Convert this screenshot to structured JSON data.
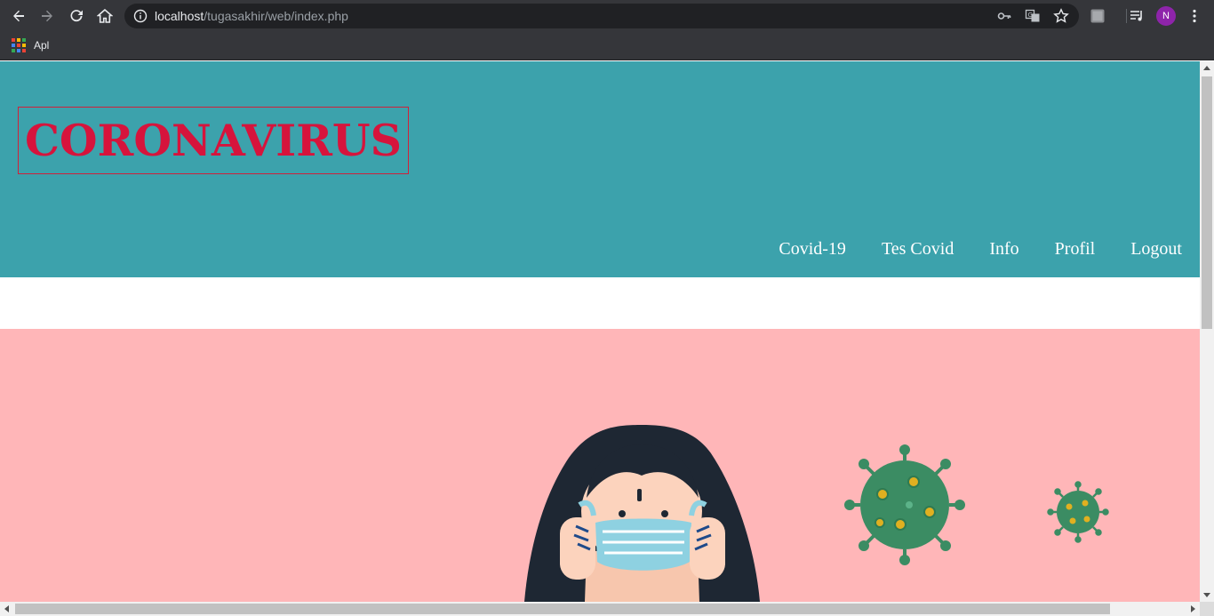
{
  "browser": {
    "url_host": "localhost",
    "url_path": "/tugasakhir/web/index.php",
    "profile_initial": "N",
    "bookmarks_label": "Apl"
  },
  "site": {
    "logo_text": "CORONAVIRUS",
    "nav": [
      "Covid-19",
      "Tes Covid",
      "Info",
      "Profil",
      "Logout"
    ]
  },
  "icons": [
    "back-icon",
    "forward-icon",
    "reload-icon",
    "home-icon",
    "info-icon",
    "key-icon",
    "translate-icon",
    "star-icon",
    "extension-icon",
    "media-icon",
    "menu-icon",
    "apps-icon"
  ],
  "colors": {
    "header_bg": "#3ca2ac",
    "logo_red": "#d6143c",
    "hero_bg": "#ffb6b8",
    "virus_green": "#3b8c63"
  }
}
